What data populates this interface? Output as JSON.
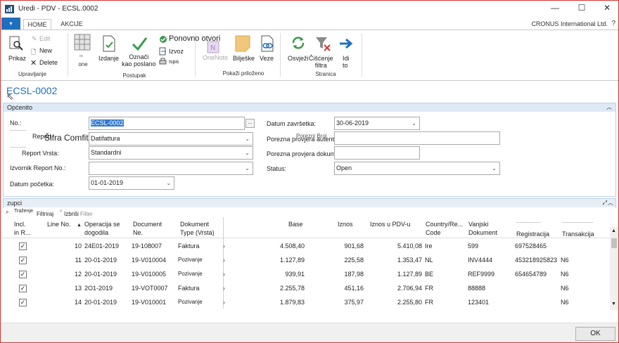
{
  "window": {
    "title": "Uredi - PDV - ECSL.0002",
    "minimize": "—",
    "maximize": "☐",
    "close": "✕"
  },
  "tabs": [
    {
      "label": "HOME"
    },
    {
      "label": "AKCIJE"
    }
  ],
  "company": "CRONUS International Ltd.",
  "help": "?",
  "ribbon": {
    "prikaz": "Prikaz",
    "edit": "Edit",
    "new": "New",
    "delete": "Delete",
    "group_upravljanje": "Upravljanje",
    "one": "one",
    "izdanje": "Izdanje",
    "oznaci": "Označi\nkao poslano",
    "ponovno_otvori": "Ponovno otvori",
    "izvoz": "Izvoz",
    "ispis": "Ispis",
    "group_postupak": "Postupak",
    "onenote": "OneNote",
    "biljeske": "Bilješke",
    "veze": "Veze",
    "group_pokazi": "Pokaži priloženo",
    "osvjezi": "Osvježi",
    "ciscenje": "Čišćenje\nfiltra",
    "idi_to": "Idi\nto",
    "group_stranica": "Stranica"
  },
  "page_title": "ECSL-0002",
  "general": {
    "heading": "Općenito",
    "no_label": "No.:",
    "no_value": "ECSL-0002",
    "report_sifra_label_small": "Report",
    "report_sifra_label": "Šifra Comfit:",
    "report_sifra_value": "Datifattura",
    "report_vrsta_label": "Report Vrsta:",
    "report_vrsta_value": "Standardni",
    "izvornik_label": "Izvornik Report No.:",
    "izvornik_value": "",
    "datum_pocetka_label": "Datum početka:",
    "datum_pocetka_value": "01-01-2019",
    "datum_zavrsetka_label": "Datum završetka:",
    "datum_zavrsetka_value": "30-06-2019",
    "porezna_autenticnosti_label": "Porezna provjera autentičnosti.",
    "porezna_autenticnosti_overlay": "Porezni Broj",
    "porezna_dokumenata_label": "Porezna provjera dokumenata br.",
    "porezna_dokumenata_value": "",
    "status_label": "Status:",
    "status_value": "Open"
  },
  "lines": {
    "heading": "zupci",
    "find": "Traženje",
    "filter": "Filtriraj",
    "clear_filter": "Izbriši",
    "filter_placeholder": "Filter",
    "columns": {
      "incl": "Incl.\nin R...",
      "line_no": "Line No.",
      "operacija": "Operacija se\ndogodila",
      "document_no": "Document\nNe.",
      "dokument_type": "Dokument\nType (Vrsta)",
      "base": "Base",
      "iznos": "Iznos",
      "iznos_pdv": "Iznos u PDV-u",
      "country": "Country/Re...\nCode",
      "vanjski": "Vanjski\nDokument",
      "registracija": "Registracija",
      "transakcija": "Transakcija"
    },
    "rows": [
      {
        "incl": "✓",
        "line_no": "10",
        "date": "24E01-2019",
        "doc_no": "19-108007",
        "type": "Faktura",
        "base": "4.508,40",
        "iznos": "901,68",
        "iznos_pdv": "5.410,08",
        "country": "Ire",
        "vanjski": "599",
        "registracija": "697528465",
        "transakcija": ""
      },
      {
        "incl": "✓",
        "line_no": "11",
        "date": "20-01-2019",
        "doc_no": "19-V010004",
        "type": "Pozivanje",
        "base": "1.127,89",
        "iznos": "225,58",
        "iznos_pdv": "1.353,47",
        "country": "NL",
        "vanjski": "INV4444",
        "registracija": "453218925823",
        "transakcija": "N6"
      },
      {
        "incl": "✓",
        "line_no": "12",
        "date": "20-01-2019",
        "doc_no": "19-V010005",
        "type": "Pozivanje",
        "base": "939,91",
        "iznos": "187,98",
        "iznos_pdv": "1.127,89",
        "country": "BE",
        "vanjski": "REF9999",
        "registracija": "654654789",
        "transakcija": "N6"
      },
      {
        "incl": "✓",
        "line_no": "13",
        "date": "2O1-2019",
        "doc_no": "19-VOT0007",
        "type": "Faktura",
        "base": "2.255,78",
        "iznos": "451,16",
        "iznos_pdv": "2.706,94",
        "country": "FR",
        "vanjski": "88888",
        "registracija": "",
        "transakcija": "N6"
      },
      {
        "incl": "✓",
        "line_no": "14",
        "date": "20-01-2019",
        "doc_no": "19-V010001",
        "type": "Pozivanje",
        "base": "1.879,83",
        "iznos": "375,97",
        "iznos_pdv": "2.255,80",
        "country": "FR",
        "vanjski": "123401",
        "registracija": "",
        "transakcija": "N6"
      }
    ]
  },
  "ok_label": "OK"
}
